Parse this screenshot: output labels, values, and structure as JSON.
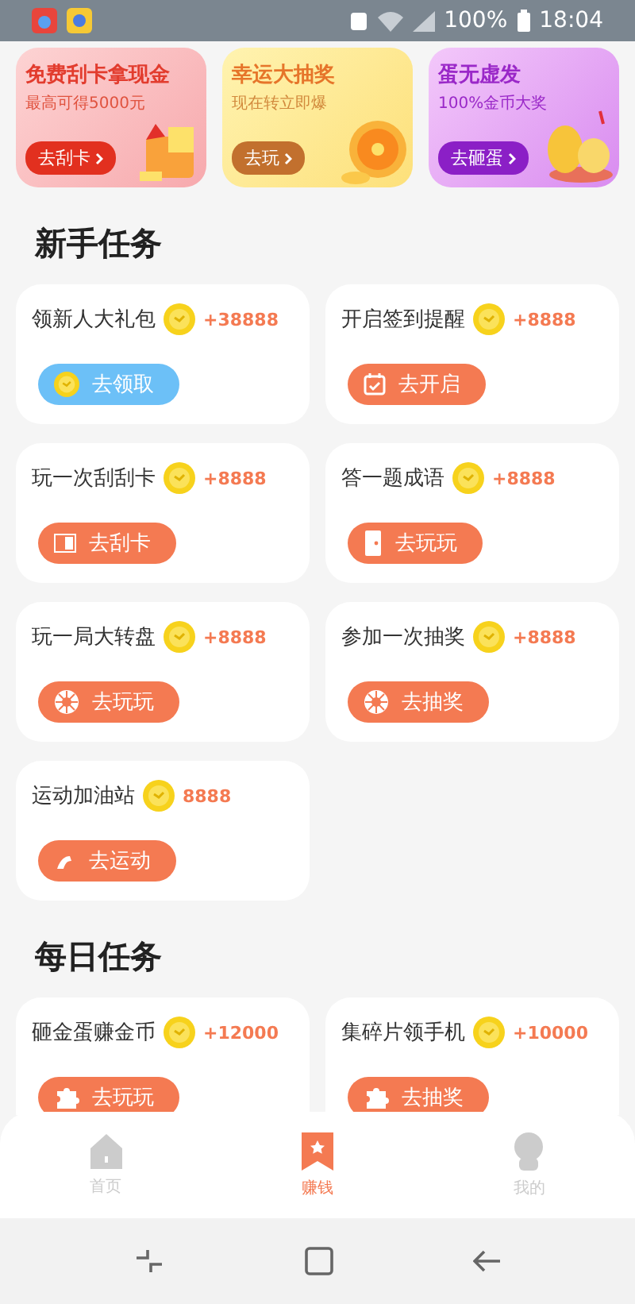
{
  "status_bar": {
    "battery": "100%",
    "time": "18:04"
  },
  "banners": [
    {
      "kind": "scratch",
      "title": "免费刮卡拿现金",
      "subtitle": "最高可得5000元",
      "button": "去刮卡"
    },
    {
      "kind": "wheel",
      "title": "幸运大抽奖",
      "subtitle": "现在转立即爆",
      "button": "去玩"
    },
    {
      "kind": "egg",
      "title": "蛋无虚发",
      "subtitle": "100%金币大奖",
      "button": "去砸蛋"
    }
  ],
  "sections": [
    {
      "title": "新手任务",
      "tasks": [
        {
          "title": "领新人大礼包",
          "reward": "+38888",
          "button": "去领取",
          "kind": "coin",
          "color": "#6cc0f7"
        },
        {
          "title": "开启签到提醒",
          "reward": "+8888",
          "button": "去开启",
          "kind": "calendar",
          "color": "#f47a52"
        },
        {
          "title": "玩一次刮刮卡",
          "reward": "+8888",
          "button": "去刮卡",
          "kind": "card",
          "color": "#f47a52"
        },
        {
          "title": "答一题成语",
          "reward": "+8888",
          "button": "去玩玩",
          "kind": "door",
          "color": "#f47a52"
        },
        {
          "title": "玩一局大转盘",
          "reward": "+8888",
          "button": "去玩玩",
          "kind": "wheel",
          "color": "#f47a52"
        },
        {
          "title": "参加一次抽奖",
          "reward": "+8888",
          "button": "去抽奖",
          "kind": "wheel",
          "color": "#f47a52"
        },
        {
          "title": "运动加油站",
          "reward": "8888",
          "button": "去运动",
          "kind": "arm",
          "color": "#f47a52"
        }
      ]
    },
    {
      "title": "每日任务",
      "tasks": [
        {
          "title": "砸金蛋赚金币",
          "reward": "+12000",
          "button": "去玩玩",
          "kind": "puzzle",
          "color": "#f47a52"
        },
        {
          "title": "集碎片领手机",
          "reward": "+10000",
          "button": "去抽奖",
          "kind": "puzzle",
          "color": "#f47a52"
        }
      ]
    }
  ],
  "bottom_nav": [
    {
      "label": "首页",
      "kind": "home",
      "selected": false
    },
    {
      "label": "赚钱",
      "kind": "bookmark",
      "selected": true
    },
    {
      "label": "我的",
      "kind": "person",
      "selected": false
    }
  ]
}
